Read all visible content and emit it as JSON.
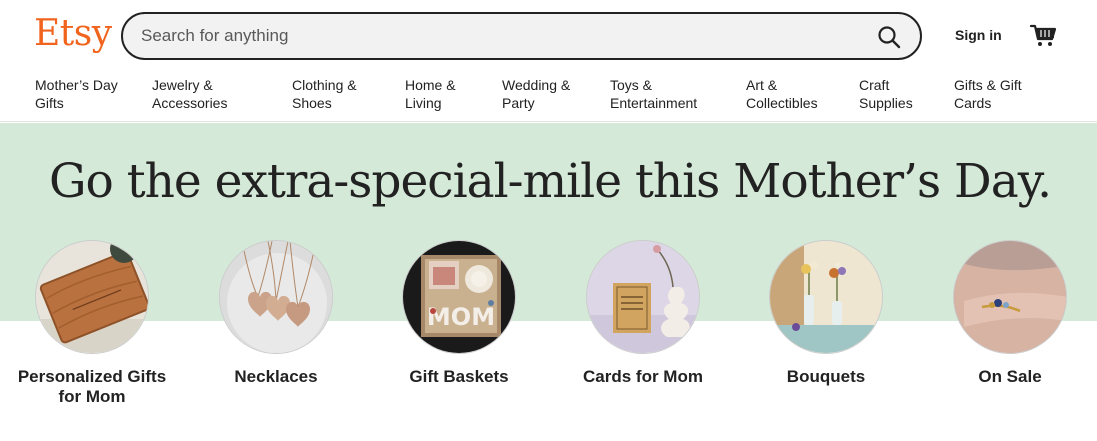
{
  "brand": {
    "logo": "Etsy",
    "accent": "#F1641E"
  },
  "search": {
    "placeholder": "Search for anything",
    "icon": "search-icon"
  },
  "header": {
    "signin_label": "Sign in",
    "cart_icon": "cart-icon"
  },
  "nav": {
    "items": [
      {
        "label": "Mother’s Day\nGifts"
      },
      {
        "label": "Jewelry &\nAccessories"
      },
      {
        "label": "Clothing &\nShoes"
      },
      {
        "label": "Home &\nLiving"
      },
      {
        "label": "Wedding &\nParty"
      },
      {
        "label": "Toys &\nEntertainment"
      },
      {
        "label": "Art &\nCollectibles"
      },
      {
        "label": "Craft\nSupplies"
      },
      {
        "label": "Gifts & Gift\nCards"
      }
    ]
  },
  "hero": {
    "title": "Go the extra-special-mile this Mother’s Day.",
    "background": "#d4e9d7"
  },
  "categories": [
    {
      "label": "Personalized Gifts for Mom"
    },
    {
      "label": "Necklaces"
    },
    {
      "label": "Gift Baskets"
    },
    {
      "label": "Cards for Mom"
    },
    {
      "label": "Bouquets"
    },
    {
      "label": "On Sale"
    }
  ]
}
